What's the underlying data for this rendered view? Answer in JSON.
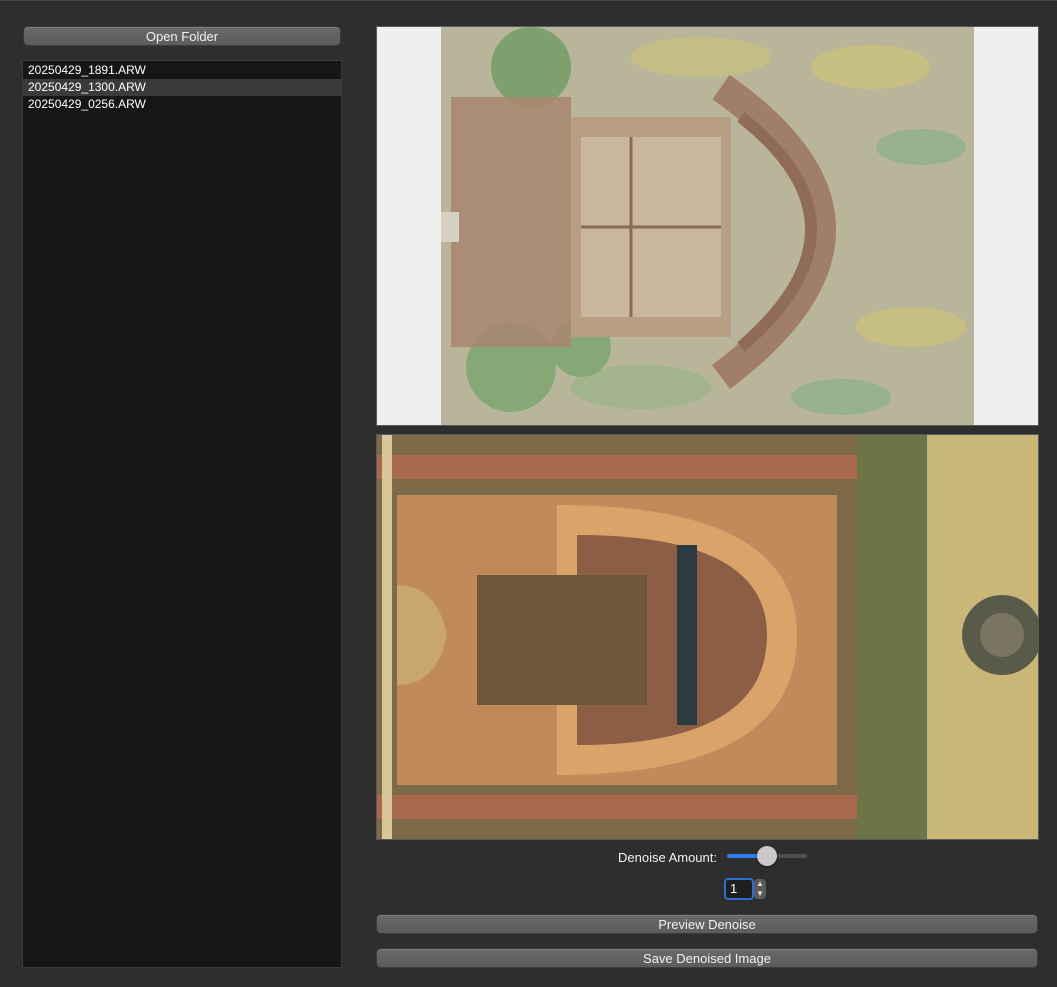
{
  "toolbar": {
    "open_folder_label": "Open Folder"
  },
  "file_list": {
    "items": [
      {
        "name": "20250429_1891.ARW",
        "selected": false
      },
      {
        "name": "20250429_1300.ARW",
        "selected": true
      },
      {
        "name": "20250429_0256.ARW",
        "selected": false
      }
    ]
  },
  "controls": {
    "denoise_label": "Denoise Amount:",
    "denoise_slider_fraction": 0.5,
    "spin_value": "1",
    "preview_label": "Preview Denoise",
    "save_label": "Save Denoised Image"
  },
  "colors": {
    "accent": "#2f7bf5",
    "list_background": "#161616",
    "selected_row": "#3b3b3b"
  }
}
